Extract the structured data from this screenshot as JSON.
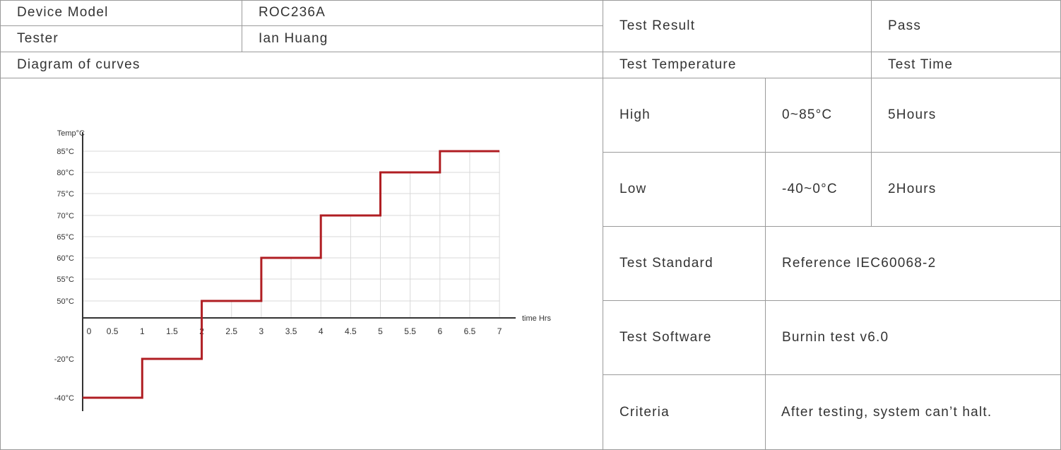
{
  "left_table": {
    "device_model_label": "Device Model",
    "device_model_value": "ROC236A",
    "tester_label": "Tester",
    "tester_value": "Ian Huang",
    "diagram_label": "Diagram of curves"
  },
  "right_table": {
    "test_result_label": "Test Result",
    "test_result_value": "Pass",
    "test_temperature_label": "Test Temperature",
    "test_time_label": "Test Time",
    "high_label": "High",
    "high_range": "0~85°C",
    "high_time": "5Hours",
    "low_label": "Low",
    "low_range": "-40~0°C",
    "low_time": "2Hours",
    "standard_label": "Test Standard",
    "standard_value": "Reference IEC60068-2",
    "software_label": "Test Software",
    "software_value": "Burnin test v6.0",
    "criteria_label": "Criteria",
    "criteria_value": "After testing, system can’t halt."
  },
  "colors": {
    "line": "#b01e23",
    "grid": "#d9d9d9",
    "axis": "#333333",
    "border": "#9a9a9a"
  },
  "chart_data": {
    "type": "line",
    "ylabel": "Temp°C",
    "xlabel": "time Hrs",
    "x_ticks": [
      "0",
      "0.5",
      "1",
      "1.5",
      "2",
      "2.5",
      "3",
      "3.5",
      "4",
      "4.5",
      "5",
      "5.5",
      "6",
      "6.5",
      "7"
    ],
    "y_ticks": [
      "85°C",
      "80°C",
      "75°C",
      "70°C",
      "65°C",
      "60°C",
      "55°C",
      "50°C",
      "-20°C",
      "-40°C"
    ],
    "grid": true,
    "series": [
      {
        "points": [
          {
            "x": 0,
            "y": "-40°C"
          },
          {
            "x": 1,
            "y": "-40°C"
          },
          {
            "x": 1,
            "y": "-20°C"
          },
          {
            "x": 2,
            "y": "-20°C"
          },
          {
            "x": 2,
            "y": "50°C"
          },
          {
            "x": 3,
            "y": "50°C"
          },
          {
            "x": 3,
            "y": "60°C"
          },
          {
            "x": 4,
            "y": "60°C"
          },
          {
            "x": 4,
            "y": "70°C"
          },
          {
            "x": 5,
            "y": "70°C"
          },
          {
            "x": 5,
            "y": "80°C"
          },
          {
            "x": 6,
            "y": "80°C"
          },
          {
            "x": 6,
            "y": "85°C"
          },
          {
            "x": 7,
            "y": "85°C"
          }
        ]
      }
    ]
  }
}
